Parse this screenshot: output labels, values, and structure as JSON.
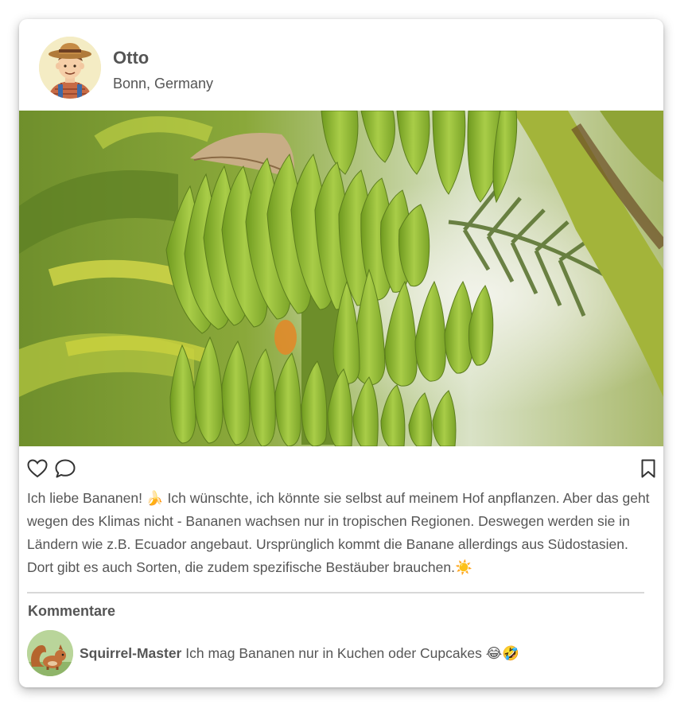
{
  "post": {
    "author": "Otto",
    "location": "Bonn, Germany",
    "avatar_icon": "farmer-avatar",
    "image_subject": "green-banana-bunch",
    "caption": "Ich liebe Bananen! 🍌 Ich wünschte, ich könnte sie selbst auf meinem Hof anpflanzen. Aber das geht wegen des Klimas nicht - Bananen wachsen nur in tropischen Regionen. Deswegen werden sie in Ländern wie z.B. Ecuador angebaut. Ursprünglich kommt die Banane allerdings aus Südostasien. Dort gibt es auch Sorten, die zudem spezifische Bestäuber brauchen.☀️"
  },
  "actions": {
    "like_icon": "heart-icon",
    "comment_icon": "comment-icon",
    "bookmark_icon": "bookmark-icon"
  },
  "comments": {
    "title": "Kommentare",
    "items": [
      {
        "author": "Squirrel-Master",
        "text": "Ich mag Bananen nur in Kuchen oder Cupcakes 😂🤣",
        "avatar_icon": "squirrel-avatar"
      }
    ]
  },
  "colors": {
    "text": "#555555",
    "divider": "#d8d8d8",
    "banana_green": "#9cc03a"
  }
}
